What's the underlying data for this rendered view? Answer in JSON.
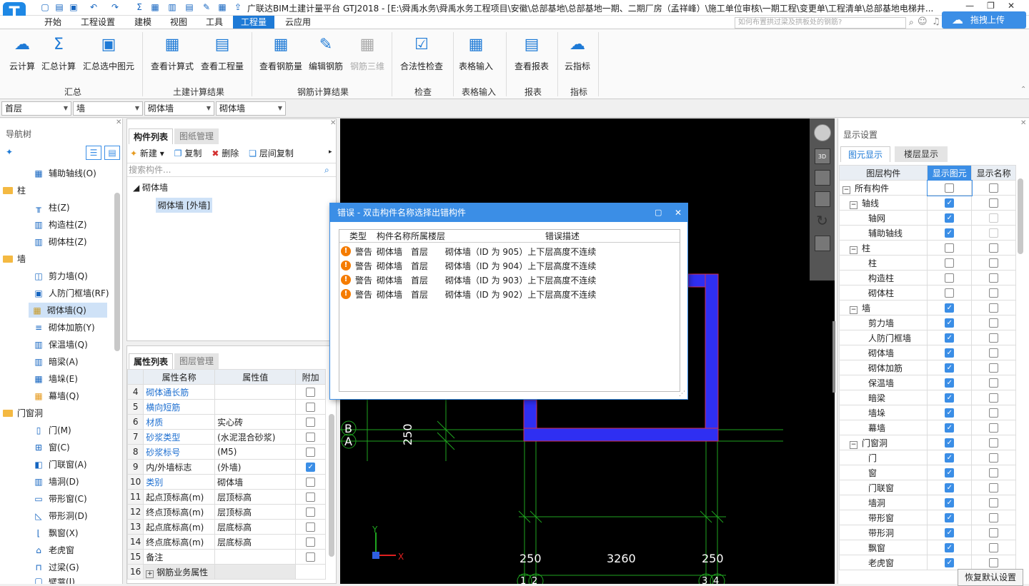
{
  "app": {
    "title": "广联达BIM土建计量平台 GTJ2018 - [E:\\舜禹水务\\舜禹水务工程项目\\安徽\\总部基地\\总部基地一期、二期厂房（孟祥峰）\\施工单位审核\\一期工程\\变更单\\工程清单\\总部基地电梯井...",
    "logo": "T",
    "search_placeholder": "如何布置拱过梁及拱板处的钢筋?",
    "upload": "拖拽上传"
  },
  "menu": [
    "开始",
    "工程设置",
    "建模",
    "视图",
    "工具",
    "工程量",
    "云应用"
  ],
  "ribbon": {
    "buttons": [
      "云计算",
      "汇总计算",
      "汇总选中图元",
      "查看计算式",
      "查看工程量",
      "查看钢筋量",
      "编辑钢筋",
      "钢筋三维",
      "合法性检查",
      "表格输入",
      "查看报表",
      "云指标"
    ],
    "groups": [
      "汇总",
      "土建计算结果",
      "钢筋计算结果",
      "检查",
      "表格输入",
      "报表",
      "指标"
    ]
  },
  "floor": [
    "首层",
    "墙",
    "砌体墙",
    "砌体墙"
  ],
  "nav": {
    "title": "导航树",
    "items": [
      "辅助轴线(O)",
      "柱",
      "柱(Z)",
      "构造柱(Z)",
      "砌体柱(Z)",
      "墙",
      "剪力墙(Q)",
      "人防门框墙(RF)",
      "砌体墙(Q)",
      "砌体加筋(Y)",
      "保温墙(Q)",
      "暗梁(A)",
      "墙垛(E)",
      "幕墙(Q)",
      "门窗洞",
      "门(M)",
      "窗(C)",
      "门联窗(A)",
      "墙洞(D)",
      "带形窗(C)",
      "带形洞(D)",
      "飘窗(X)",
      "老虎窗",
      "过梁(G)",
      "壁龛(I)"
    ]
  },
  "complist": {
    "tabs": [
      "构件列表",
      "图纸管理"
    ],
    "toolbar": [
      "新建",
      "复制",
      "删除",
      "层间复制"
    ],
    "search": "搜索构件...",
    "tree_root": "砌体墙",
    "tree_item": "砌体墙 [外墙]"
  },
  "props": {
    "tabs": [
      "属性列表",
      "图层管理"
    ],
    "headers": [
      "属性名称",
      "属性值",
      "附加"
    ],
    "rows": [
      {
        "n": "4",
        "name": "砌体通长筋",
        "val": "",
        "blue": true,
        "chk": false
      },
      {
        "n": "5",
        "name": "横向短筋",
        "val": "",
        "blue": true,
        "chk": false
      },
      {
        "n": "6",
        "name": "材质",
        "val": "实心砖",
        "blue": true,
        "chk": false
      },
      {
        "n": "7",
        "name": "砂浆类型",
        "val": "(水泥混合砂浆)",
        "blue": true,
        "chk": false
      },
      {
        "n": "8",
        "name": "砂浆标号",
        "val": "(M5)",
        "blue": true,
        "chk": false
      },
      {
        "n": "9",
        "name": "内/外墙标志",
        "val": "(外墙)",
        "blue": false,
        "chk": true
      },
      {
        "n": "10",
        "name": "类别",
        "val": "砌体墙",
        "blue": true,
        "chk": false
      },
      {
        "n": "11",
        "name": "起点顶标高(m)",
        "val": "层顶标高",
        "blue": false,
        "chk": false
      },
      {
        "n": "12",
        "name": "终点顶标高(m)",
        "val": "层顶标高",
        "blue": false,
        "chk": false
      },
      {
        "n": "13",
        "name": "起点底标高(m)",
        "val": "层底标高",
        "blue": false,
        "chk": false
      },
      {
        "n": "14",
        "name": "终点底标高(m)",
        "val": "层底标高",
        "blue": false,
        "chk": false
      },
      {
        "n": "15",
        "name": "备注",
        "val": "",
        "blue": false,
        "chk": false
      },
      {
        "n": "16",
        "name": "钢筋业务属性",
        "val": "",
        "blue": false,
        "chk": null
      }
    ]
  },
  "canvas": {
    "axis_b": "B",
    "axis_a": "A",
    "dim_left": "250",
    "dim_bottom": [
      "250",
      "3260",
      "250"
    ],
    "axis_nums": [
      "1",
      "2",
      "3",
      "4"
    ],
    "y": "Y",
    "x": "X"
  },
  "dialog": {
    "title": "错误 - 双击构件名称选择出错构件",
    "headers": [
      "类型",
      "构件名称",
      "所属楼层",
      "错误描述"
    ],
    "rows": [
      {
        "type": "警告",
        "name": "砌体墙",
        "floor": "首层",
        "desc": "砌体墙（ID 为 905）上下层高度不连续"
      },
      {
        "type": "警告",
        "name": "砌体墙",
        "floor": "首层",
        "desc": "砌体墙（ID 为 904）上下层高度不连续"
      },
      {
        "type": "警告",
        "name": "砌体墙",
        "floor": "首层",
        "desc": "砌体墙（ID 为 903）上下层高度不连续"
      },
      {
        "type": "警告",
        "name": "砌体墙",
        "floor": "首层",
        "desc": "砌体墙（ID 为 902）上下层高度不连续"
      }
    ]
  },
  "display": {
    "title": "显示设置",
    "tabs": [
      "图元显示",
      "楼层显示"
    ],
    "headers": [
      "图层构件",
      "显示图元",
      "显示名称"
    ],
    "rows": [
      {
        "name": "所有构件",
        "lvl": 0,
        "fold": true,
        "a": false,
        "b": false
      },
      {
        "name": "轴线",
        "lvl": 1,
        "fold": true,
        "a": true,
        "b": false
      },
      {
        "name": "轴网",
        "lvl": 2,
        "fold": false,
        "a": true,
        "b": false
      },
      {
        "name": "辅助轴线",
        "lvl": 2,
        "fold": false,
        "a": true,
        "b": false
      },
      {
        "name": "柱",
        "lvl": 1,
        "fold": true,
        "a": false,
        "b": false
      },
      {
        "name": "柱",
        "lvl": 2,
        "fold": false,
        "a": false,
        "b": false
      },
      {
        "name": "构造柱",
        "lvl": 2,
        "fold": false,
        "a": false,
        "b": false
      },
      {
        "name": "砌体柱",
        "lvl": 2,
        "fold": false,
        "a": false,
        "b": false
      },
      {
        "name": "墙",
        "lvl": 1,
        "fold": true,
        "a": true,
        "b": false
      },
      {
        "name": "剪力墙",
        "lvl": 2,
        "fold": false,
        "a": true,
        "b": false
      },
      {
        "name": "人防门框墙",
        "lvl": 2,
        "fold": false,
        "a": true,
        "b": false
      },
      {
        "name": "砌体墙",
        "lvl": 2,
        "fold": false,
        "a": true,
        "b": false
      },
      {
        "name": "砌体加筋",
        "lvl": 2,
        "fold": false,
        "a": true,
        "b": false
      },
      {
        "name": "保温墙",
        "lvl": 2,
        "fold": false,
        "a": true,
        "b": false
      },
      {
        "name": "暗梁",
        "lvl": 2,
        "fold": false,
        "a": true,
        "b": false
      },
      {
        "name": "墙垛",
        "lvl": 2,
        "fold": false,
        "a": true,
        "b": false
      },
      {
        "name": "幕墙",
        "lvl": 2,
        "fold": false,
        "a": true,
        "b": false
      },
      {
        "name": "门窗洞",
        "lvl": 1,
        "fold": true,
        "a": true,
        "b": false
      },
      {
        "name": "门",
        "lvl": 2,
        "fold": false,
        "a": true,
        "b": false
      },
      {
        "name": "窗",
        "lvl": 2,
        "fold": false,
        "a": true,
        "b": false
      },
      {
        "name": "门联窗",
        "lvl": 2,
        "fold": false,
        "a": true,
        "b": false
      },
      {
        "name": "墙洞",
        "lvl": 2,
        "fold": false,
        "a": true,
        "b": false
      },
      {
        "name": "带形窗",
        "lvl": 2,
        "fold": false,
        "a": true,
        "b": false
      },
      {
        "name": "带形洞",
        "lvl": 2,
        "fold": false,
        "a": true,
        "b": false
      },
      {
        "name": "飘窗",
        "lvl": 2,
        "fold": false,
        "a": true,
        "b": false
      },
      {
        "name": "老虎窗",
        "lvl": 2,
        "fold": false,
        "a": true,
        "b": false
      }
    ],
    "restore": "恢复默认设置"
  }
}
